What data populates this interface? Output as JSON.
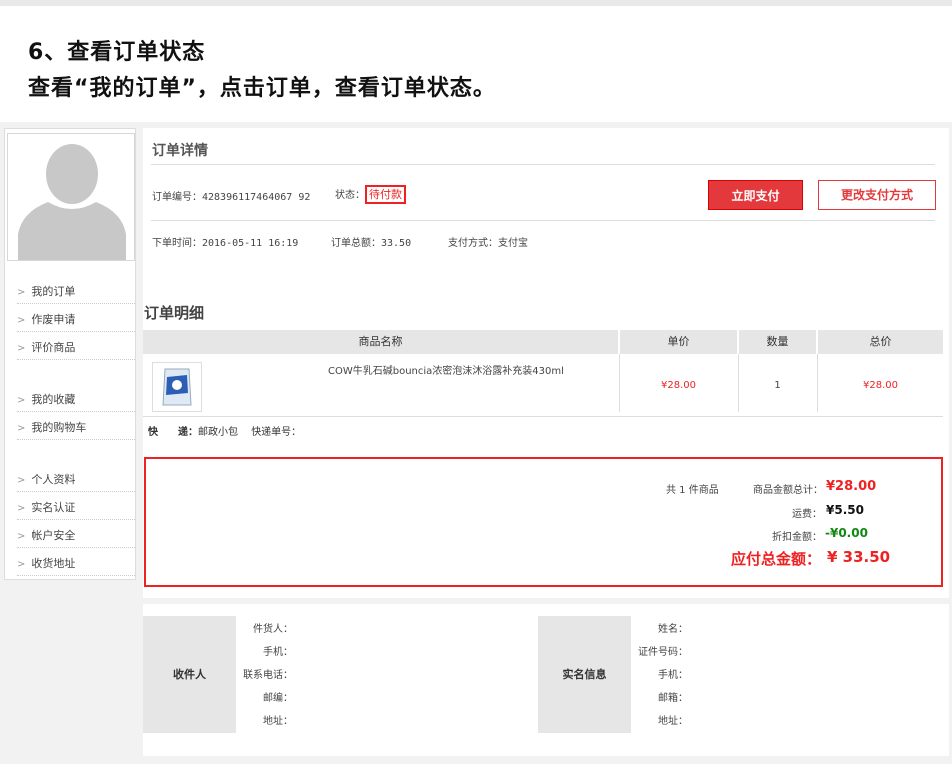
{
  "heading": {
    "title": "6、查看订单状态",
    "subtitle": "查看“我的订单”，点击订单，查看订单状态。"
  },
  "sidebar": {
    "menu": [
      {
        "label": "我的订单"
      },
      {
        "label": "作废申请"
      },
      {
        "label": "评价商品"
      },
      {
        "label": "我的收藏"
      },
      {
        "label": "我的购物车"
      },
      {
        "label": "个人资料"
      },
      {
        "label": "实名认证"
      },
      {
        "label": "帐户安全"
      },
      {
        "label": "收货地址"
      }
    ]
  },
  "order_detail": {
    "title": "订单详情",
    "order_no_label": "订单编号：",
    "order_no": "428396117464067 92",
    "status_label": "状态：",
    "status": "待付款",
    "pay_now": "立即支付",
    "change_payment": "更改支付方式",
    "order_time_label": "下单时间：",
    "order_time": "2016-05-11 16:19",
    "total_label": "订单总额：",
    "total": "33.50",
    "payment_label": "支付方式：",
    "payment": "支付宝"
  },
  "order_items": {
    "title": "订单明细",
    "headers": [
      "商品名称",
      "单价",
      "数量",
      "总价"
    ],
    "rows": [
      {
        "name": "COW牛乳石碱bouncia浓密泡沫沐浴露补充装430ml",
        "unit_price": "¥28.00",
        "qty": "1",
        "total": "¥28.00"
      }
    ],
    "express_label": "快　　递：",
    "express": "邮政小包",
    "tracking_label": "快递单号："
  },
  "summary": {
    "count_text": "共 1 件商品",
    "goods_total_label": "商品金额总计：",
    "goods_total": "¥28.00",
    "shipping_label": "运费：",
    "shipping": "¥5.50",
    "discount_label": "折扣金额：",
    "discount": "-¥0.00",
    "payable_label": "应付总金额：",
    "payable": "¥ 33.50"
  },
  "receiver": {
    "block_label": "收件人",
    "fields": [
      "件货人：",
      "手机：",
      "联系电话：",
      "邮编：",
      "地址："
    ]
  },
  "realname": {
    "block_label": "实名信息",
    "fields": [
      "姓名：",
      "证件号码：",
      "手机：",
      "邮箱：",
      "地址："
    ]
  },
  "colors": {
    "accent": "#e4393c",
    "discount": "#118811"
  }
}
